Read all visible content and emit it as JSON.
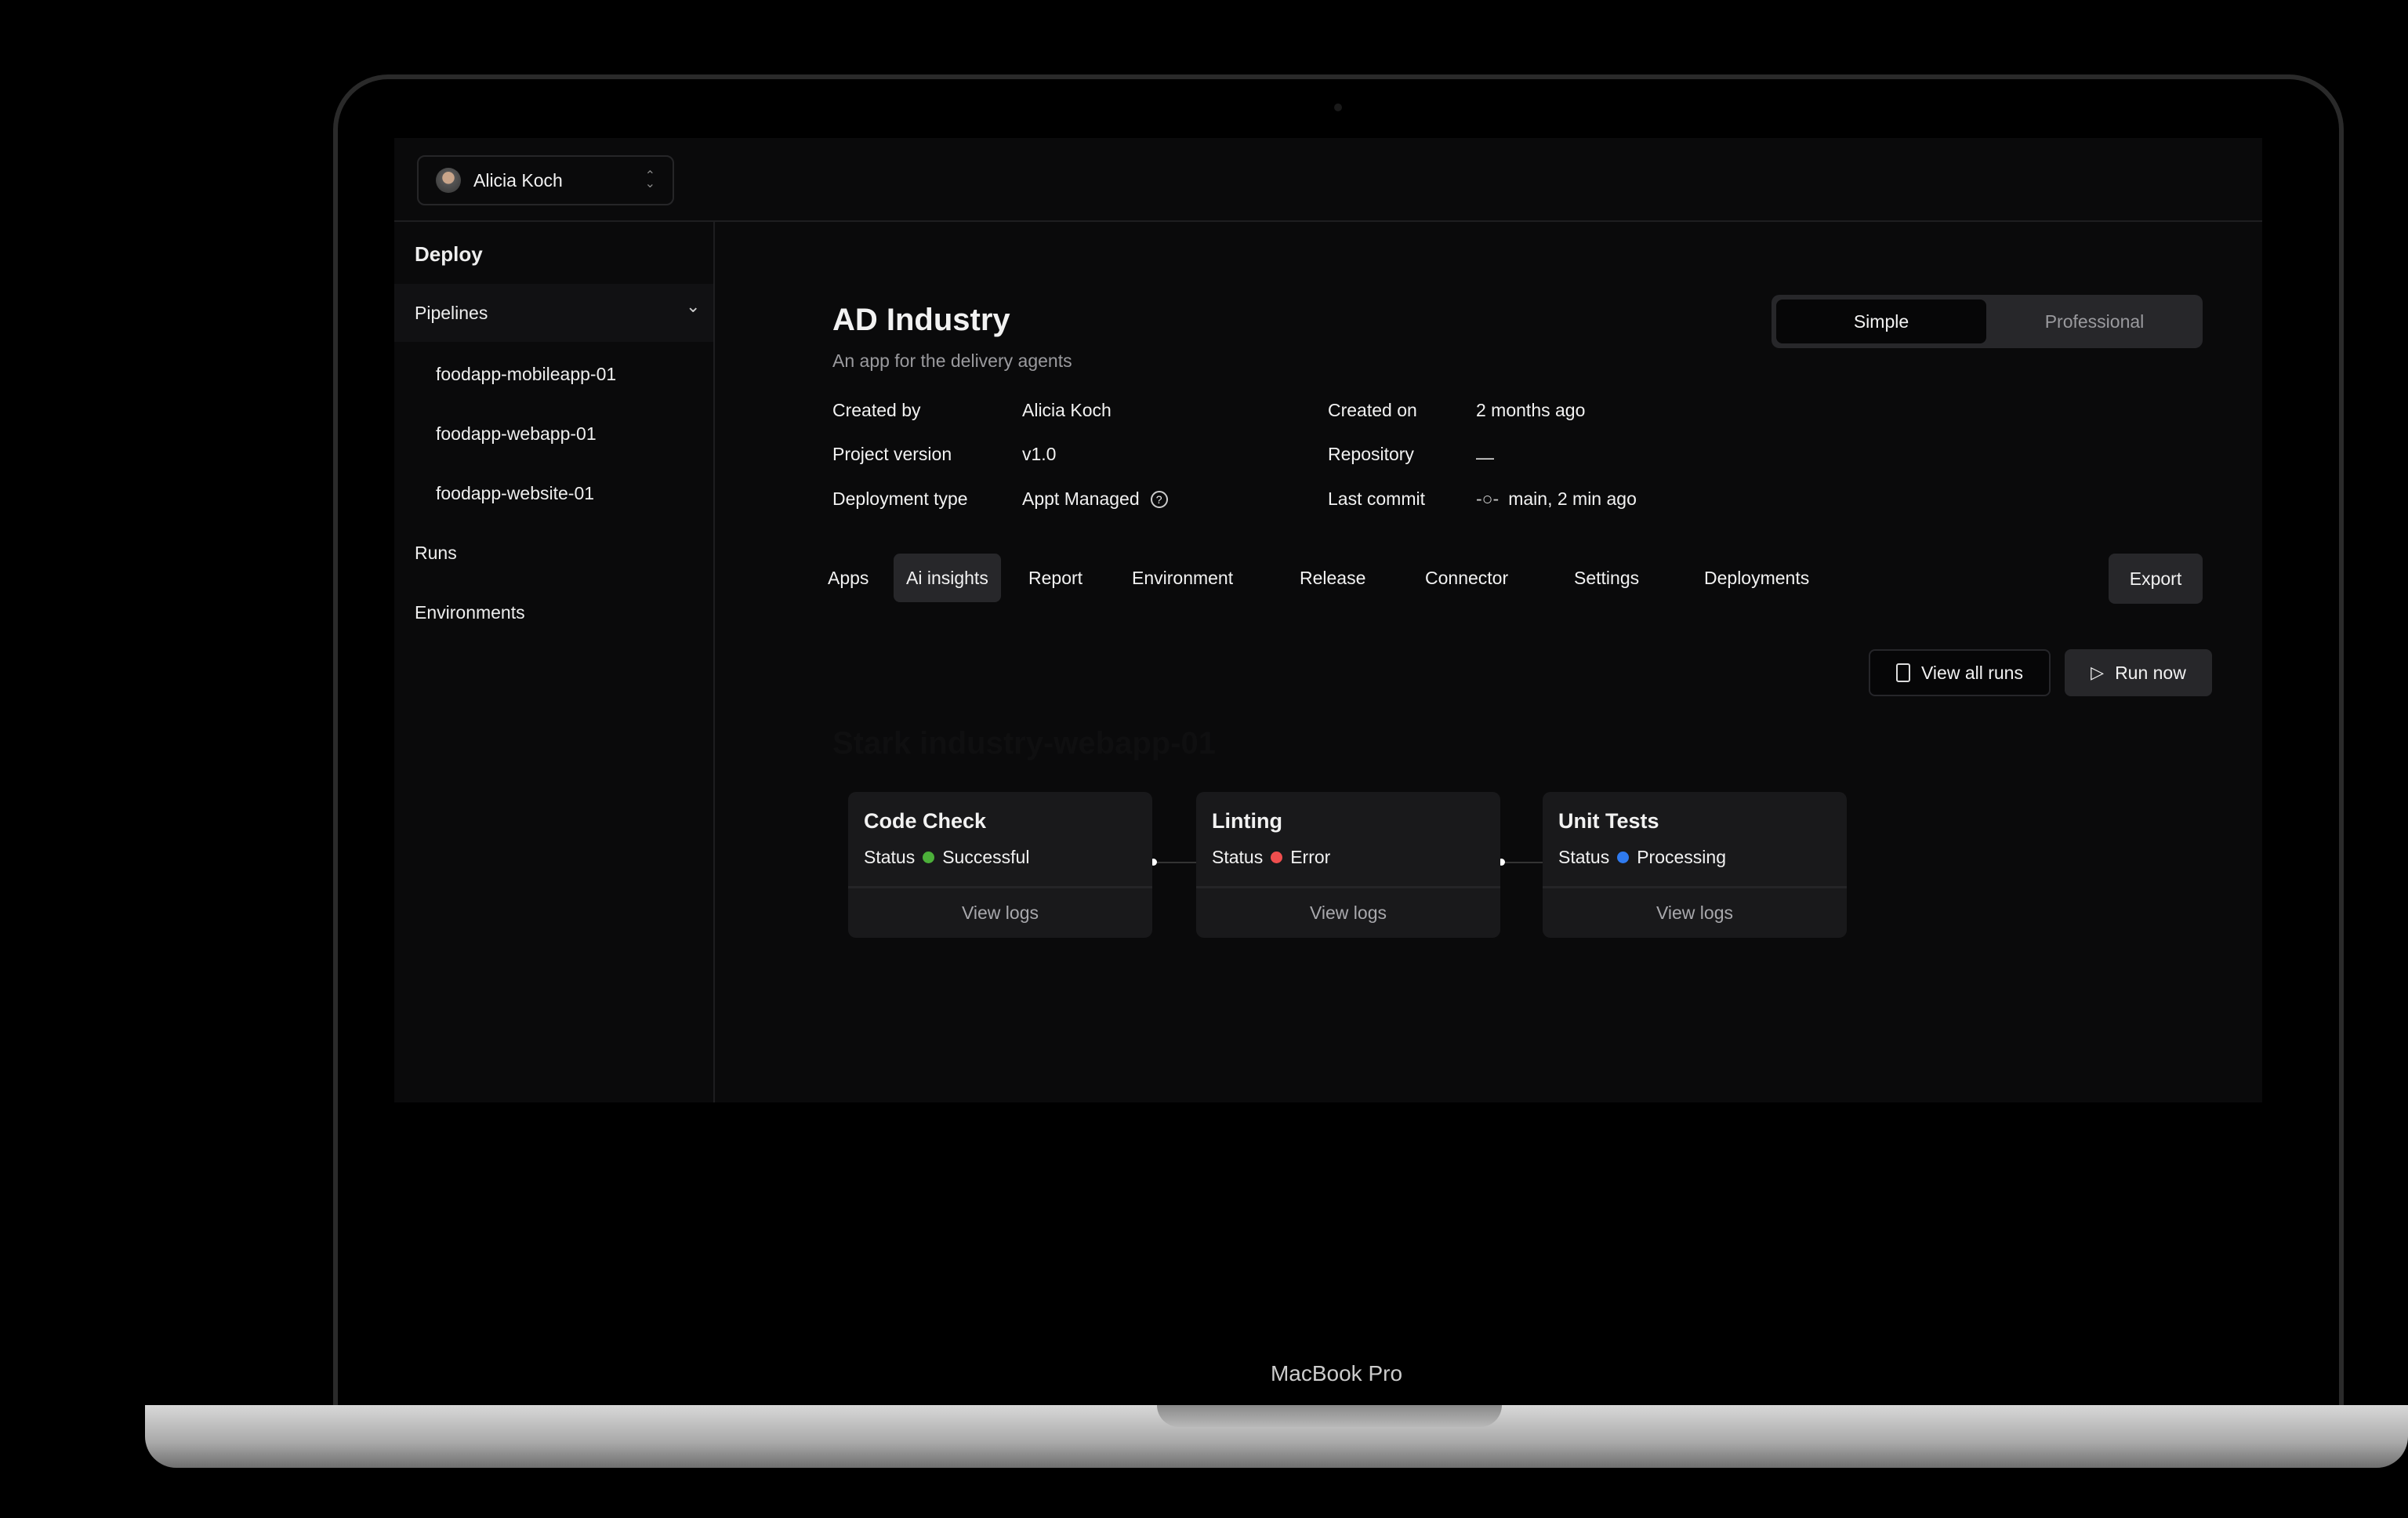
{
  "device": {
    "label": "MacBook Pro"
  },
  "account": {
    "name": "Alicia Koch"
  },
  "sidebar": {
    "title": "Deploy",
    "pipelines": {
      "label": "Pipelines",
      "items": [
        "foodapp-mobileapp-01",
        "foodapp-webapp-01",
        "foodapp-website-01"
      ]
    },
    "runs": "Runs",
    "environments": "Environments"
  },
  "project": {
    "title": "AD Industry",
    "subtitle": "An app for the delivery agents",
    "meta": [
      {
        "label": "Created by",
        "value": "Alicia Koch"
      },
      {
        "label": "Project version",
        "value": "v1.0"
      },
      {
        "label": "Deployment type",
        "value": "Appt Managed"
      },
      {
        "label": "Created on",
        "value": "2 months ago"
      },
      {
        "label": "Repository",
        "value": "—"
      },
      {
        "label": "Last commit",
        "value": "main, 2 min ago"
      }
    ]
  },
  "mode_toggle": {
    "options": [
      "Simple",
      "Professional"
    ],
    "selected": "Simple"
  },
  "tabs": [
    "Apps",
    "Ai insights",
    "Report",
    "Environment",
    "Release",
    "Connector",
    "Settings",
    "Deployments"
  ],
  "active_tab": "Ai insights",
  "actions": {
    "export": "Export",
    "view_all_runs": "View all runs",
    "run_now": "Run now"
  },
  "pipeline": {
    "title": "Stark industry-webapp-01",
    "stages": [
      {
        "name": "Code Check",
        "status_label": "Status",
        "status": "Successful",
        "color": "#4caf3a",
        "action": "View logs"
      },
      {
        "name": "Linting",
        "status_label": "Status",
        "status": "Error",
        "color": "#ef4e4e",
        "action": "View logs"
      },
      {
        "name": "Unit Tests",
        "status_label": "Status",
        "status": "Processing",
        "color": "#2f7bf0",
        "action": "View logs"
      }
    ]
  }
}
